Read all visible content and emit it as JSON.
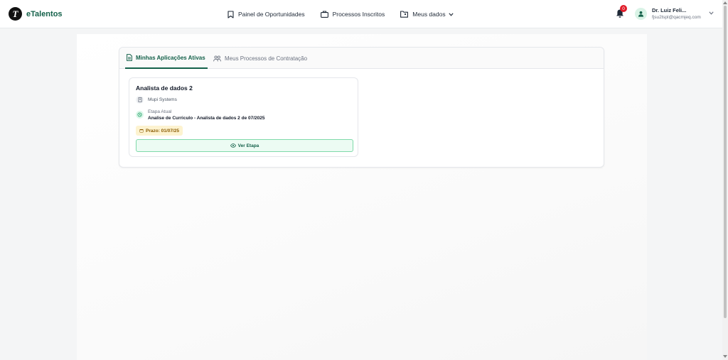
{
  "brand": {
    "name": "eTalentos",
    "logo_letter": "T"
  },
  "nav": {
    "items": [
      {
        "label": "Painel de Oportunidades",
        "icon": "bookmark-icon"
      },
      {
        "label": "Processos Inscritos",
        "icon": "briefcase-icon"
      },
      {
        "label": "Meus dados",
        "icon": "folder-user-icon"
      }
    ]
  },
  "notifications": {
    "count": "0"
  },
  "user": {
    "name": "Dr. Luiz Feli...",
    "email": "fjsu2lspl@qacmjeq.com"
  },
  "tabs": [
    {
      "label": "Minhas Aplicações Ativas",
      "active": true,
      "icon": "document-icon"
    },
    {
      "label": "Meus Processos de Contratação",
      "active": false,
      "icon": "users-icon"
    }
  ],
  "application": {
    "title": "Analista de dados 2",
    "company": "Mupi Systems",
    "stage_label": "Etapa Atual",
    "stage_value": "Analise de Curriculo - Analista de dados 2 de 07/2025",
    "deadline": "Prazo: 01/07/25",
    "action_label": "Ver Etapa"
  },
  "colors": {
    "brand_green": "#14614a",
    "accent_green": "#7fd9a9",
    "badge_red": "#e11d2a",
    "deadline_bg": "#fdf3d0"
  }
}
